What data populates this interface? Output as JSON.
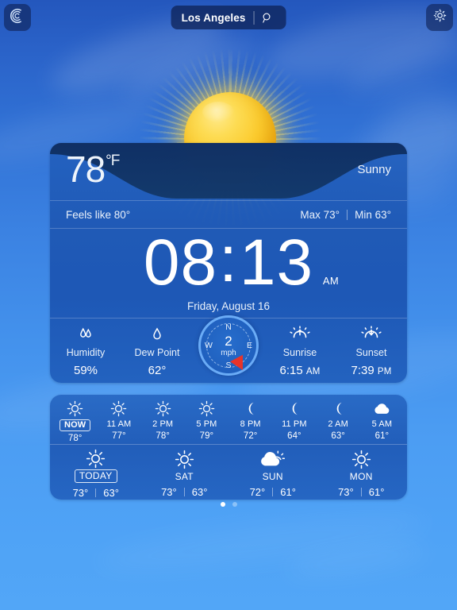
{
  "topbar": {
    "logo_icon": "app-logo-icon",
    "gear_icon": "gear-icon",
    "search": {
      "city": "Los Angeles",
      "search_icon": "search-icon"
    }
  },
  "current": {
    "temperature": "78",
    "unit": "°F",
    "condition": "Sunny",
    "feels_like": "Feels like 80°",
    "max": "Max 73°",
    "min": "Min 63°",
    "weather_icon": "sun-icon"
  },
  "clock": {
    "hours": "08",
    "colon": ":",
    "minutes": "13",
    "ampm": "AM",
    "date": "Friday, August 16"
  },
  "details": [
    {
      "label": "Humidity",
      "value": "59%",
      "icon": "humidity-icon"
    },
    {
      "label": "Dew Point",
      "value": "62°",
      "icon": "dewpoint-icon"
    },
    {
      "label": "Sunrise",
      "value": "6:15",
      "suffix": "AM",
      "icon": "sunrise-icon"
    },
    {
      "label": "Sunset",
      "value": "7:39",
      "suffix": "PM",
      "icon": "sunset-icon"
    }
  ],
  "wind": {
    "speed": "2",
    "unit": "mph",
    "north": "N",
    "south": "S",
    "west": "W",
    "east": "E",
    "needle_color": "#e8342a"
  },
  "hourly": [
    {
      "label": "NOW",
      "temp": "78°",
      "icon": "sun-icon",
      "is_now": true
    },
    {
      "label": "11 AM",
      "temp": "77°",
      "icon": "sun-icon"
    },
    {
      "label": "2 PM",
      "temp": "78°",
      "icon": "sun-icon"
    },
    {
      "label": "5 PM",
      "temp": "79°",
      "icon": "sun-icon"
    },
    {
      "label": "8 PM",
      "temp": "72°",
      "icon": "moon-icon"
    },
    {
      "label": "11 PM",
      "temp": "64°",
      "icon": "moon-icon"
    },
    {
      "label": "2 AM",
      "temp": "63°",
      "icon": "moon-icon"
    },
    {
      "label": "5 AM",
      "temp": "61°",
      "icon": "cloud-icon"
    }
  ],
  "daily": [
    {
      "label": "TODAY",
      "high": "73°",
      "low": "63°",
      "icon": "sun-icon",
      "is_today": true
    },
    {
      "label": "SAT",
      "high": "73°",
      "low": "63°",
      "icon": "sun-icon"
    },
    {
      "label": "SUN",
      "high": "72°",
      "low": "61°",
      "icon": "cloud-sun-icon"
    },
    {
      "label": "MON",
      "high": "73°",
      "low": "61°",
      "icon": "sun-icon"
    }
  ],
  "pagination": {
    "total": 2,
    "active": 0
  },
  "colors": {
    "sky_top": "#2457bd",
    "sky_bottom": "#52a6f7",
    "card": "#1d56b2",
    "sun": "#fbcb2e",
    "accent_text": "#ffffff"
  }
}
